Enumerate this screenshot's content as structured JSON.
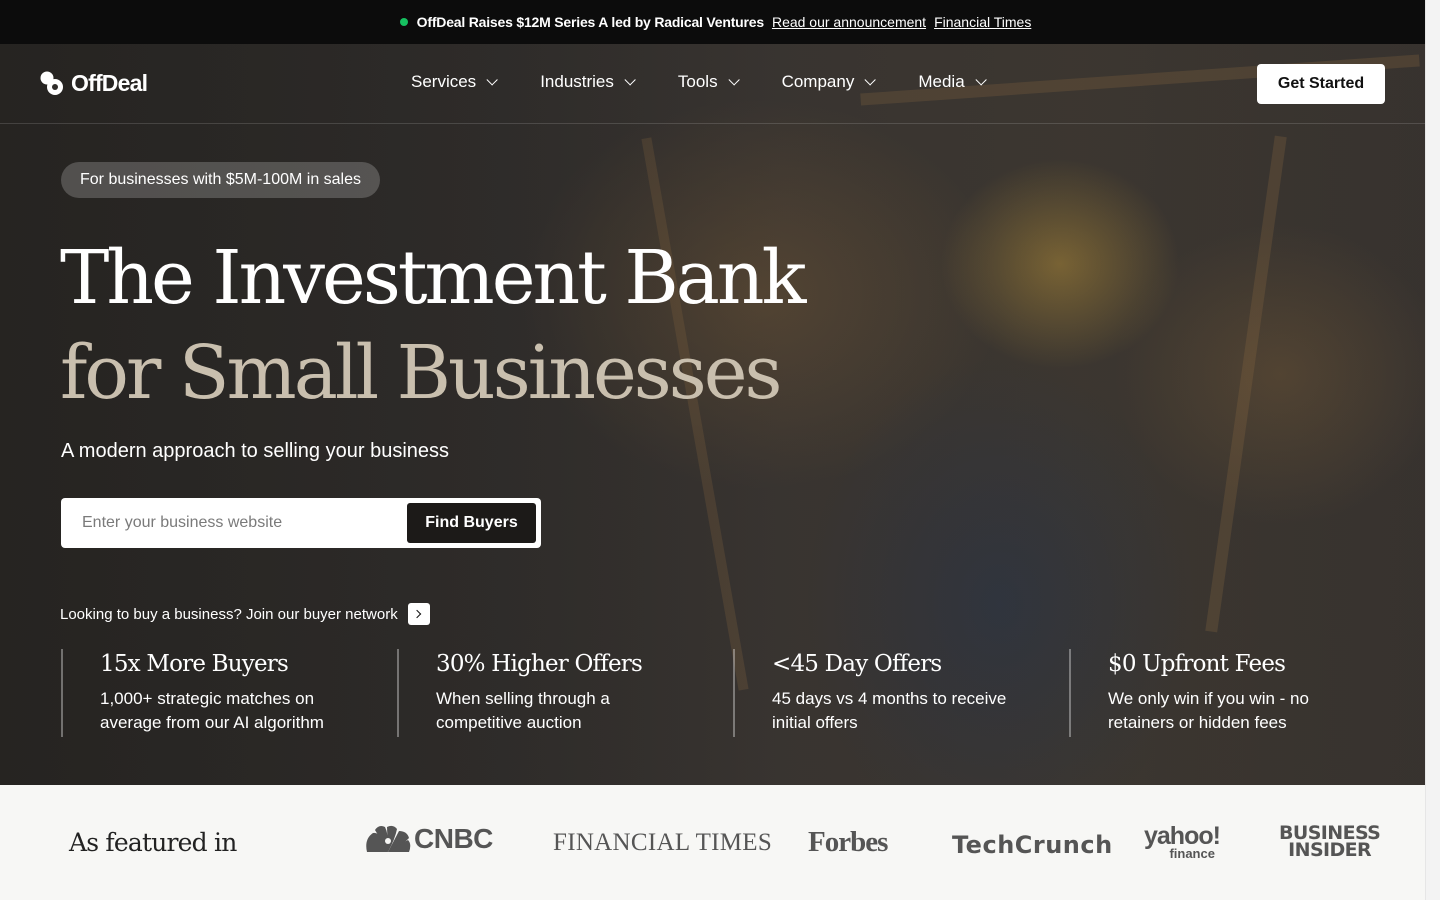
{
  "announcement": {
    "headline": "OffDeal Raises $12M Series A led by Radical Ventures",
    "link1": "Read our announcement",
    "link2": "Financial Times"
  },
  "nav": {
    "logo": "OffDeal",
    "items": [
      {
        "label": "Services"
      },
      {
        "label": "Industries"
      },
      {
        "label": "Tools"
      },
      {
        "label": "Company"
      },
      {
        "label": "Media"
      }
    ],
    "cta": "Get Started"
  },
  "hero": {
    "pill": "For businesses with $5M-100M in sales",
    "title_line1": "The Investment Bank",
    "title_line2": "for Small Businesses",
    "subtitle": "A modern approach to selling your business",
    "search_placeholder": "Enter your business website",
    "search_value": "",
    "search_button": "Find Buyers",
    "buyer_link": "Looking to buy a business? Join our buyer network"
  },
  "stats": [
    {
      "title": "15x More Buyers",
      "desc": "1,000+ strategic matches on average from our AI algorithm"
    },
    {
      "title": "30% Higher Offers",
      "desc": "When selling through a competitive auction"
    },
    {
      "title": "<45 Day Offers",
      "desc": "45 days vs 4 months to receive initial offers"
    },
    {
      "title": "$0 Upfront Fees",
      "desc": "We only win if you win - no retainers or hidden fees"
    }
  ],
  "featured": {
    "label": "As featured in",
    "logos": {
      "cnbc": "CNBC",
      "ft": "FINANCIAL TIMES",
      "forbes": "Forbes",
      "techcrunch": "TechCrunch",
      "yahoo_main": "yahoo!",
      "yahoo_sub": "finance",
      "bi_line1": "BUSINESS",
      "bi_line2": "INSIDER"
    }
  },
  "colors": {
    "announce_bg": "#0c0c0c",
    "status_dot": "#16c060",
    "title_accent": "#c9bfae",
    "button_dark": "#1c1a18"
  },
  "icons": {
    "status": "green-dot-icon",
    "dropdown": "chevron-down-icon",
    "arrow": "arrow-right-icon",
    "cnbc": "peacock-icon"
  }
}
